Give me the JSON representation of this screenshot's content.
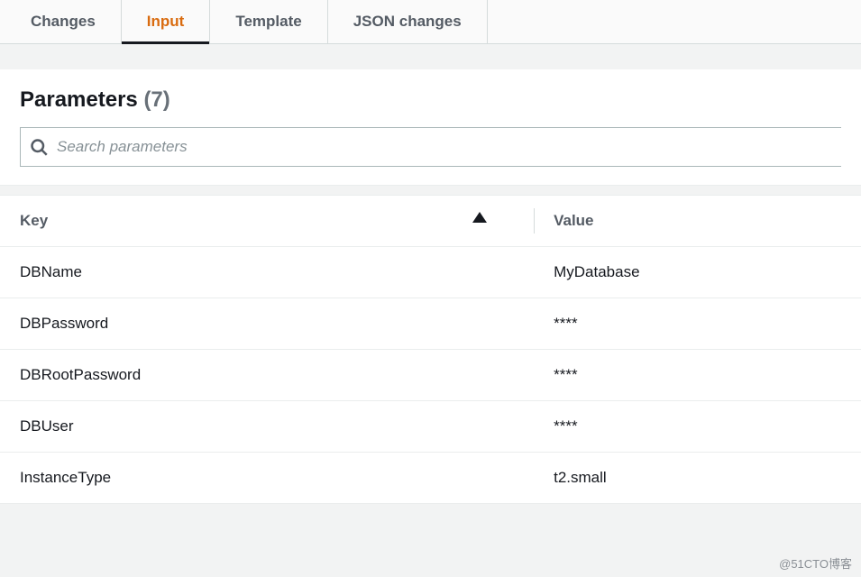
{
  "tabs": [
    {
      "label": "Changes",
      "active": false
    },
    {
      "label": "Input",
      "active": true
    },
    {
      "label": "Template",
      "active": false
    },
    {
      "label": "JSON changes",
      "active": false
    }
  ],
  "section": {
    "title": "Parameters",
    "count": "(7)"
  },
  "search": {
    "placeholder": "Search parameters"
  },
  "columns": {
    "key": "Key",
    "value": "Value"
  },
  "rows": [
    {
      "key": "DBName",
      "value": "MyDatabase"
    },
    {
      "key": "DBPassword",
      "value": "****"
    },
    {
      "key": "DBRootPassword",
      "value": "****"
    },
    {
      "key": "DBUser",
      "value": "****"
    },
    {
      "key": "InstanceType",
      "value": "t2.small"
    }
  ],
  "watermark": "@51CTO博客"
}
